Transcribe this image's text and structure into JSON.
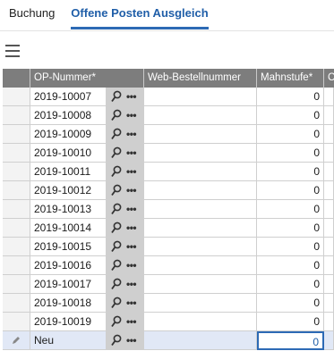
{
  "tabs": [
    "Buchung",
    "Offene Posten Ausgleich"
  ],
  "columns": {
    "op_nummer": "OP-Nummer*",
    "web_bestellnummer": "Web-Bestellnummer",
    "mahnstufe": "Mahnstufe*",
    "extra": "C"
  },
  "rows": [
    {
      "op": "2019-10007",
      "web": "",
      "mahnstufe": "0"
    },
    {
      "op": "2019-10008",
      "web": "",
      "mahnstufe": "0"
    },
    {
      "op": "2019-10009",
      "web": "",
      "mahnstufe": "0"
    },
    {
      "op": "2019-10010",
      "web": "",
      "mahnstufe": "0"
    },
    {
      "op": "2019-10011",
      "web": "",
      "mahnstufe": "0"
    },
    {
      "op": "2019-10012",
      "web": "",
      "mahnstufe": "0"
    },
    {
      "op": "2019-10013",
      "web": "",
      "mahnstufe": "0"
    },
    {
      "op": "2019-10014",
      "web": "",
      "mahnstufe": "0"
    },
    {
      "op": "2019-10015",
      "web": "",
      "mahnstufe": "0"
    },
    {
      "op": "2019-10016",
      "web": "",
      "mahnstufe": "0"
    },
    {
      "op": "2019-10017",
      "web": "",
      "mahnstufe": "0"
    },
    {
      "op": "2019-10018",
      "web": "",
      "mahnstufe": "0"
    },
    {
      "op": "2019-10019",
      "web": "",
      "mahnstufe": "0"
    }
  ],
  "new_row": {
    "op": "Neu",
    "web": "",
    "mahnstufe": "0"
  },
  "lookup_dots": "•••",
  "colors": {
    "accent": "#2d6ab5",
    "header_bg": "#7d7d7d",
    "new_row_bg": "#e1e8f6"
  }
}
